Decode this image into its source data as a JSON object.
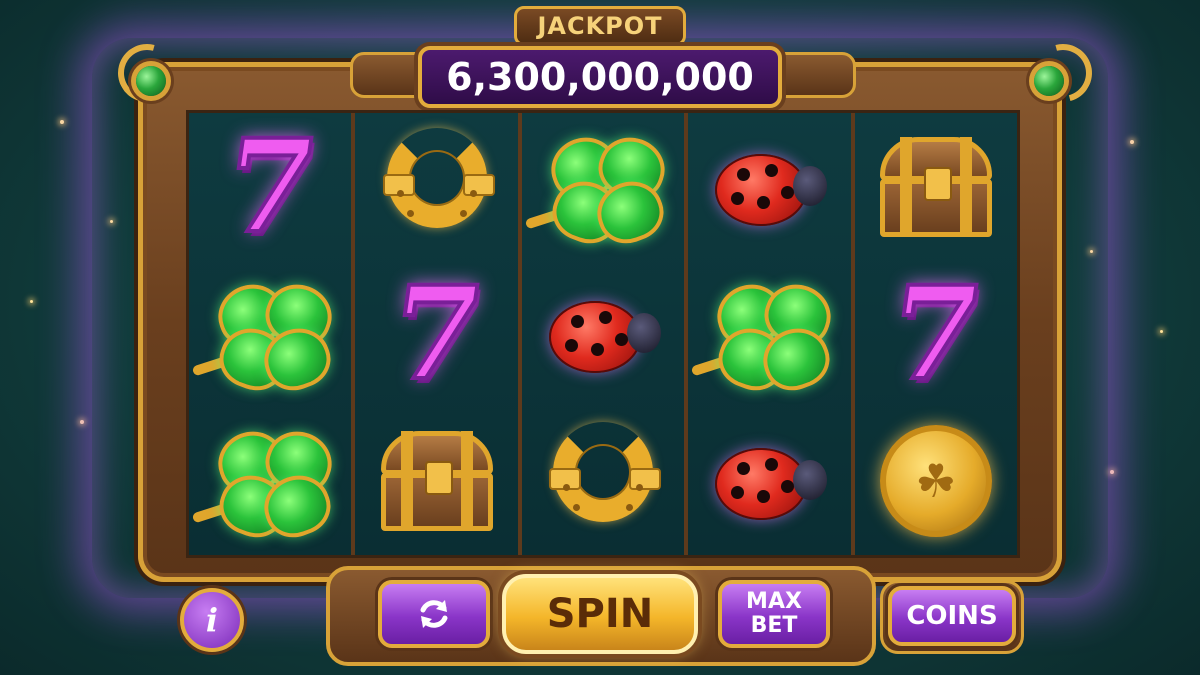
{
  "jackpot": {
    "label": "JACKPOT",
    "amount": "6,300,000,000"
  },
  "reels": [
    [
      "seven",
      "clover",
      "clover"
    ],
    [
      "horseshoe",
      "seven",
      "treasure-chest"
    ],
    [
      "clover",
      "ladybug",
      "horseshoe"
    ],
    [
      "ladybug",
      "clover",
      "ladybug"
    ],
    [
      "treasure-chest",
      "seven",
      "gold-coin"
    ]
  ],
  "symbols": {
    "seven": {
      "glyph": "7",
      "color": "#ef5cf0"
    },
    "clover": {
      "color": "#2bc33b"
    },
    "horseshoe": {
      "color": "#e9ad2c"
    },
    "ladybug": {
      "color": "#e02a1e"
    },
    "treasure-chest": {
      "color": "#9a6334"
    },
    "gold-coin": {
      "glyph": "☘",
      "color": "#e5ab2a"
    }
  },
  "controls": {
    "info": "i",
    "autoplay_icon": "refresh-icon",
    "spin": "SPIN",
    "max_bet_line1": "MAX",
    "max_bet_line2": "BET",
    "coins": "COINS"
  },
  "colors": {
    "background": "#124140",
    "frame_gold": "#d8a238",
    "button_purple": "#8a35c8",
    "spin_gold": "#f4b62a",
    "glow": "#be5aff"
  }
}
